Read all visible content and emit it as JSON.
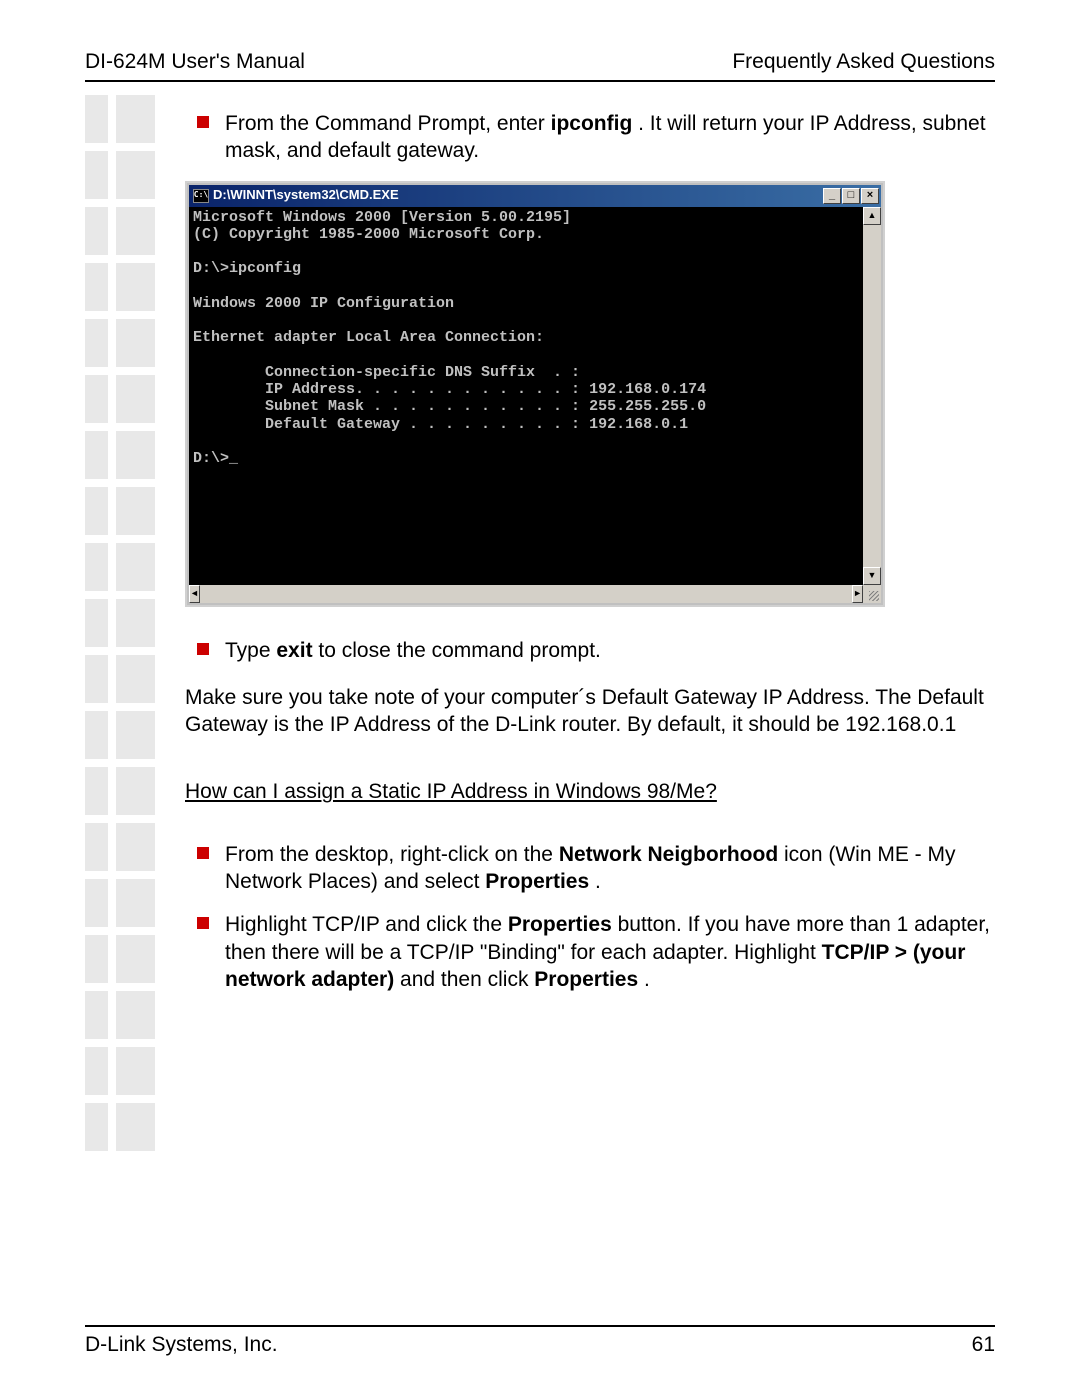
{
  "header": {
    "left": "DI-624M User's Manual",
    "right": "Frequently Asked Questions"
  },
  "bullets": {
    "b1_prefix": "From the Command Prompt, enter ",
    "b1_cmd": "ipconfig",
    "b1_suffix": " . It will return your IP Address, subnet mask, and default gateway.",
    "b2_prefix": "Type ",
    "b2_cmd": "exit",
    "b2_suffix": " to close the command prompt.",
    "b3_prefix": "From the desktop, right-click on the ",
    "b3_bold1": "Network Neigborhood",
    "b3_mid": "   icon (Win ME - My Network Places) and select ",
    "b3_bold2": "Properties",
    "b3_end": " .",
    "b4_prefix": "Highlight TCP/IP and click the ",
    "b4_bold1": "Properties",
    "b4_mid": "  button. If you have more than 1 adapter, then there will be a TCP/IP \"Binding\" for each adapter. Highlight ",
    "b4_bold2": "TCP/IP > (your network adapter)",
    "b4_mid2": "  and then click ",
    "b4_bold3": "Properties",
    "b4_end": " ."
  },
  "cmd": {
    "title": "D:\\WINNT\\system32\\CMD.EXE",
    "iconText": "C:\\",
    "minBtn": "_",
    "maxBtn": "□",
    "closeBtn": "×",
    "upArrow": "▲",
    "downArrow": "▼",
    "leftArrow": "◄",
    "rightArrow": "►",
    "body": "Microsoft Windows 2000 [Version 5.00.2195]\n(C) Copyright 1985-2000 Microsoft Corp.\n\nD:\\>ipconfig\n\nWindows 2000 IP Configuration\n\nEthernet adapter Local Area Connection:\n\n        Connection-specific DNS Suffix  . :\n        IP Address. . . . . . . . . . . . : 192.168.0.174\n        Subnet Mask . . . . . . . . . . . : 255.255.255.0\n        Default Gateway . . . . . . . . . : 192.168.0.1\n\nD:\\>_"
  },
  "paragraph": "Make sure you take note of your computer´s Default Gateway IP Address. The Default Gateway is the IP Address of the D-Link router. By default, it should be 192.168.0.1",
  "question": "How can I assign a Static IP Address in Windows 98/Me?",
  "footer": {
    "left": "D-Link Systems, Inc.",
    "right": "61"
  }
}
